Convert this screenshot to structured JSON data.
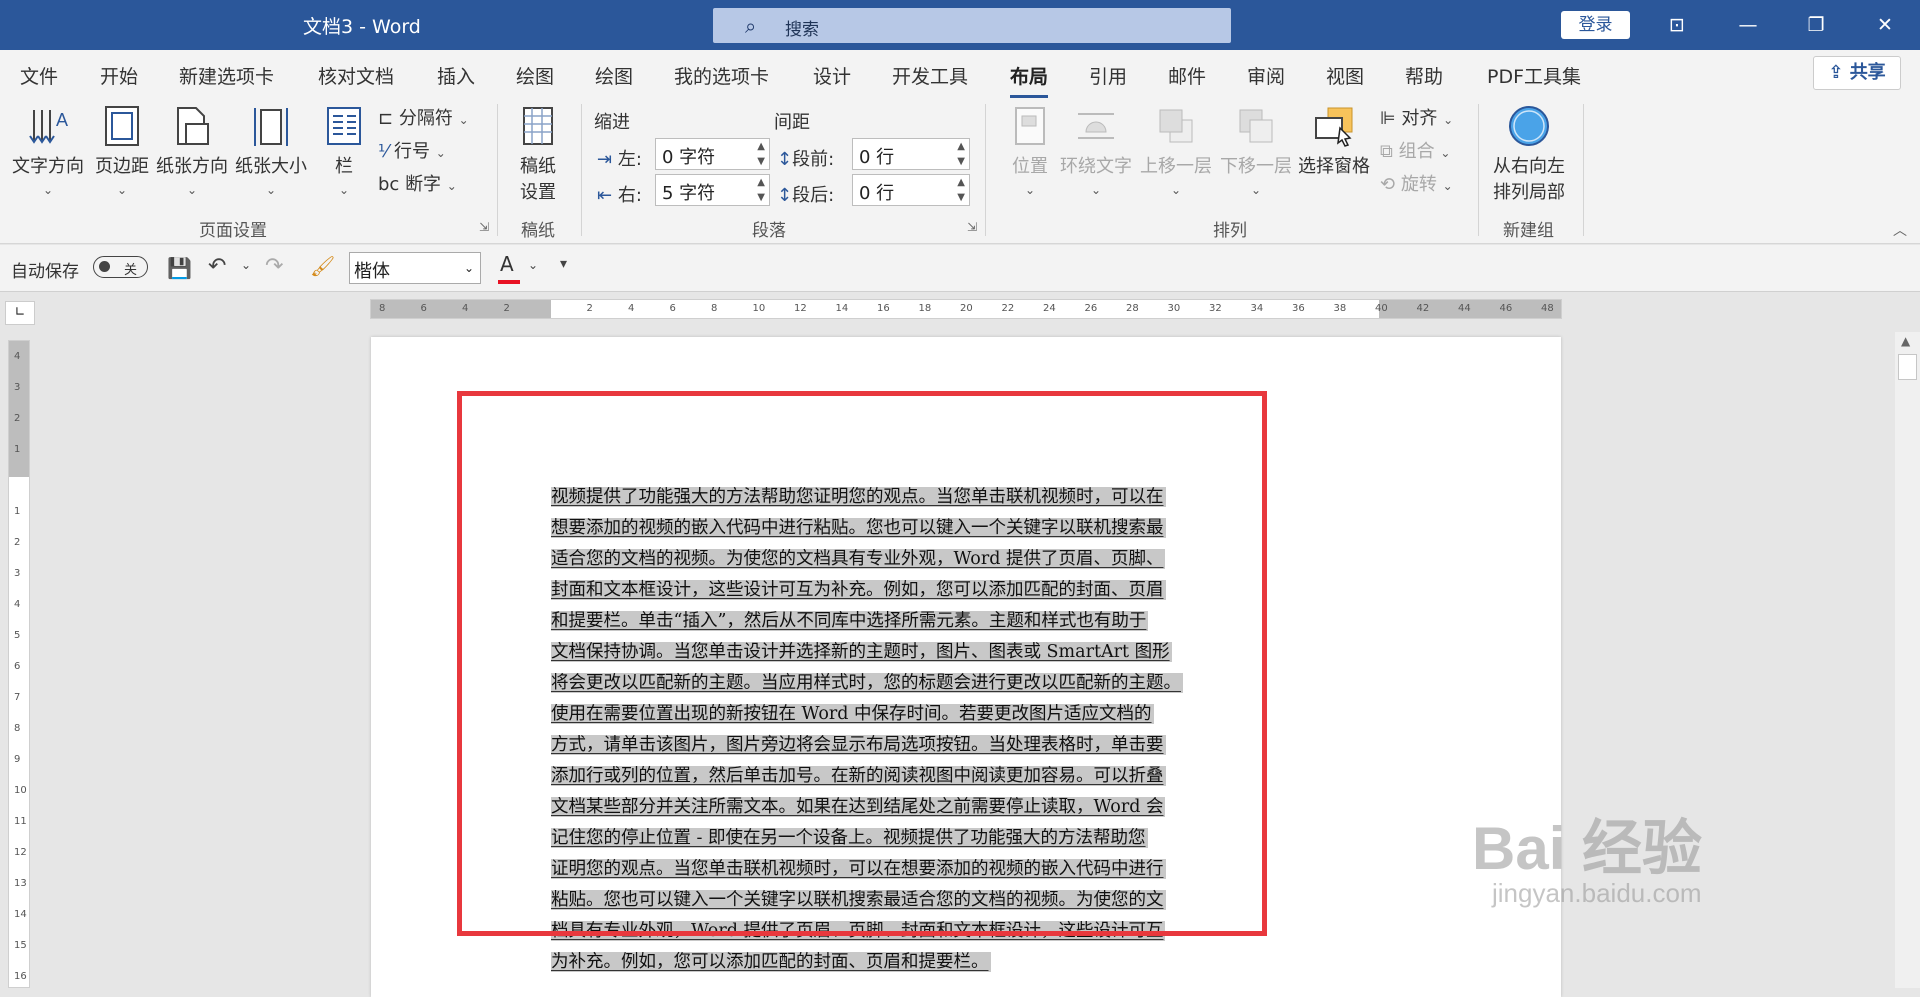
{
  "window": {
    "title": "文档3  -  Word",
    "search_placeholder": "搜索",
    "login_label": "登录",
    "controls": [
      "ribbon-display-icon",
      "minimize-icon",
      "restore-icon",
      "close-icon"
    ]
  },
  "menu": {
    "tabs": [
      "文件",
      "开始",
      "新建选项卡",
      "核对文档",
      "插入",
      "绘图",
      "绘图",
      "我的选项卡",
      "设计",
      "开发工具",
      "布局",
      "引用",
      "邮件",
      "审阅",
      "视图",
      "帮助",
      "PDF工具集"
    ],
    "active_tab": "布局",
    "share_label": "共享"
  },
  "ribbon": {
    "page_setup": {
      "label": "页面设置",
      "text_direction": "文字方向",
      "margins": "页边距",
      "orientation": "纸张方向",
      "size": "纸张大小",
      "columns": "栏",
      "breaks": "分隔符",
      "line_numbers": "行号",
      "hyphenation": "断字"
    },
    "manuscript": {
      "label": "稿纸",
      "settings": "稿纸\n设置",
      "settings_line1": "稿纸",
      "settings_line2": "设置"
    },
    "paragraph": {
      "label": "段落",
      "indent_title": "缩进",
      "spacing_title": "间距",
      "left_label": "左:",
      "left_value": "0 字符",
      "right_label": "右:",
      "right_value": "5 字符",
      "before_label": "段前:",
      "before_value": "0 行",
      "after_label": "段后:",
      "after_value": "0 行"
    },
    "arrange": {
      "label": "排列",
      "position": "位置",
      "wrap_text": "环绕文字",
      "bring_forward": "上移一层",
      "send_backward": "下移一层",
      "selection_pane": "选择窗格",
      "align": "对齐",
      "group": "组合",
      "rotate": "旋转"
    },
    "new_group": {
      "label": "新建组",
      "rtl_line1": "从右向左",
      "rtl_line2": "排列局部"
    }
  },
  "qat": {
    "autosave_label": "自动保存",
    "autosave_state": "关",
    "font_name": "楷体",
    "font_color": "#e81123"
  },
  "ruler": {
    "h_ticks": [
      "8",
      "6",
      "4",
      "2",
      "",
      "2",
      "4",
      "6",
      "8",
      "10",
      "12",
      "14",
      "16",
      "18",
      "20",
      "22",
      "24",
      "26",
      "28",
      "30",
      "32",
      "34",
      "36",
      "38",
      "40",
      "42",
      "44",
      "46",
      "48"
    ],
    "v_ticks": [
      "4",
      "3",
      "2",
      "1",
      "",
      "1",
      "2",
      "3",
      "4",
      "5",
      "6",
      "7",
      "8",
      "9",
      "10",
      "11",
      "12",
      "13",
      "14",
      "15",
      "16"
    ]
  },
  "document": {
    "lines": [
      "视频提供了功能强大的方法帮助您证明您的观点。当您单击联机视频时，可以在",
      "想要添加的视频的嵌入代码中进行粘贴。您也可以键入一个关键字以联机搜索最",
      "适合您的文档的视频。为使您的文档具有专业外观，Word 提供了页眉、页脚、",
      "封面和文本框设计，这些设计可互为补充。例如，您可以添加匹配的封面、页眉",
      "和提要栏。单击“插入”，然后从不同库中选择所需元素。主题和样式也有助于",
      "文档保持协调。当您单击设计并选择新的主题时，图片、图表或 SmartArt 图形",
      "将会更改以匹配新的主题。当应用样式时，您的标题会进行更改以匹配新的主题。",
      "使用在需要位置出现的新按钮在 Word 中保存时间。若要更改图片适应文档的",
      "方式，请单击该图片，图片旁边将会显示布局选项按钮。当处理表格时，单击要",
      "添加行或列的位置，然后单击加号。在新的阅读视图中阅读更加容易。可以折叠",
      "文档某些部分并关注所需文本。如果在达到结尾处之前需要停止读取，Word 会",
      "记住您的停止位置 - 即使在另一个设备上。视频提供了功能强大的方法帮助您",
      "证明您的观点。当您单击联机视频时，可以在想要添加的视频的嵌入代码中进行",
      "粘贴。您也可以键入一个关键字以联机搜索最适合您的文档的视频。为使您的文",
      "档具有专业外观，Word 提供了页眉、页脚、封面和文本框设计，这些设计可互",
      "为补充。例如，您可以添加匹配的封面、页眉和提要栏。"
    ]
  },
  "watermark": {
    "brand": "Bai 经验",
    "url": "jingyan.baidu.com"
  }
}
